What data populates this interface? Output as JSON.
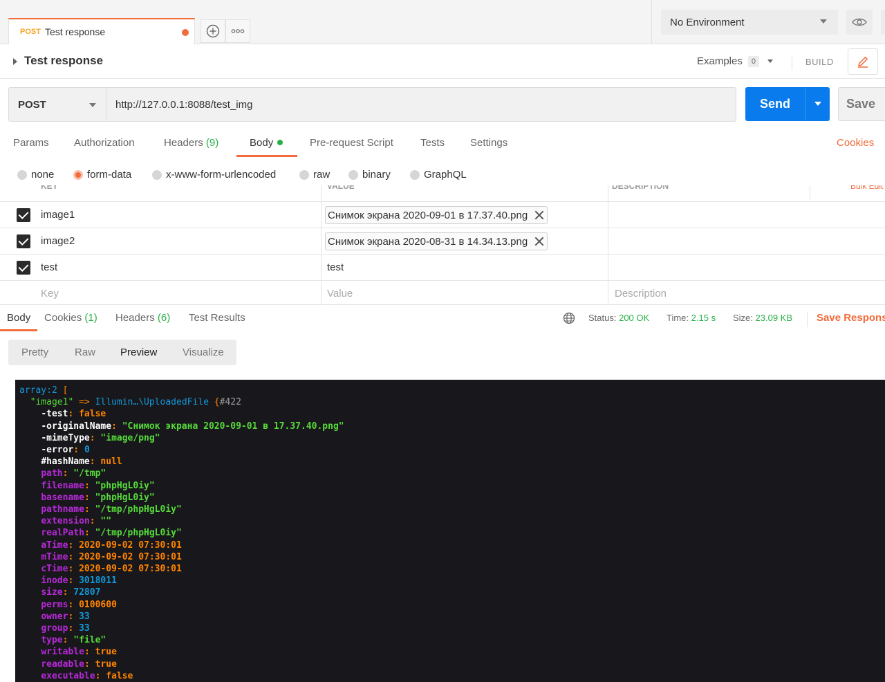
{
  "colors": {
    "accent": "#f26b3a",
    "send_blue": "#097bed",
    "success_green": "#26b047",
    "dump_bg": "#18171b"
  },
  "top_tab": {
    "method": "POST",
    "name": "Test response",
    "new_tab_icon": "plus-circle-icon",
    "more_icon": "ellipsis-icon"
  },
  "environment": {
    "selected": "No Environment",
    "eye_icon": "eye-icon"
  },
  "title_row": {
    "title": "Test response",
    "examples_label": "Examples",
    "examples_count": "0",
    "build_label": "BUILD",
    "edit_icon": "pencil-icon"
  },
  "url_row": {
    "method": "POST",
    "url": "http://127.0.0.1:8088/test_img",
    "send_label": "Send",
    "save_label": "Save"
  },
  "request_tabs": {
    "params": "Params",
    "authorization": "Authorization",
    "headers_label": "Headers",
    "headers_count": "(9)",
    "body": "Body",
    "pre_request": "Pre-request Script",
    "tests": "Tests",
    "settings": "Settings",
    "cookies": "Cookies"
  },
  "body_types": {
    "none": "none",
    "form_data": "form-data",
    "urlencoded": "x-www-form-urlencoded",
    "raw": "raw",
    "binary": "binary",
    "graphql": "GraphQL",
    "selected": "form-data"
  },
  "form_table": {
    "columns": [
      "KEY",
      "VALUE",
      "DESCRIPTION"
    ],
    "bulk_edit": "Bulk Edit",
    "rows": [
      {
        "checked": true,
        "key": "image1",
        "value": "Снимок экрана 2020-09-01 в 17.37.40.png",
        "is_file": true
      },
      {
        "checked": true,
        "key": "image2",
        "value": "Снимок экрана 2020-08-31 в 14.34.13.png",
        "is_file": true
      },
      {
        "checked": true,
        "key": "test",
        "value": "test",
        "is_file": false
      }
    ],
    "key_placeholder": "Key",
    "value_placeholder": "Value",
    "description_placeholder": "Description"
  },
  "response_tabs": {
    "body": "Body",
    "cookies_label": "Cookies",
    "cookies_count": "(1)",
    "headers_label": "Headers",
    "headers_count": "(6)",
    "test_results": "Test Results",
    "globe_icon": "globe-icon"
  },
  "response_status": {
    "status_label": "Status:",
    "status_value": "200 OK",
    "time_label": "Time:",
    "time_value": "2.15 s",
    "size_label": "Size:",
    "size_value": "23.09 KB",
    "save_response": "Save Response"
  },
  "view_modes": {
    "pretty": "Pretty",
    "raw": "Raw",
    "preview": "Preview",
    "visualize": "Visualize",
    "active": "Preview"
  },
  "dump": {
    "header_type": "array:2",
    "header_bracket": "[",
    "entry_key": "\"image1\"",
    "arrow": "=>",
    "class_name": "Illumin…\\UploadedFile",
    "object_open": "{",
    "object_id": "#422",
    "props": [
      {
        "name": "-test",
        "vis": "private",
        "value": "false",
        "type": "const"
      },
      {
        "name": "-originalName",
        "vis": "private",
        "value": "\"Снимок экрана 2020-09-01 в 17.37.40.png\"",
        "type": "str"
      },
      {
        "name": "-mimeType",
        "vis": "private",
        "value": "\"image/png\"",
        "type": "str"
      },
      {
        "name": "-error",
        "vis": "private",
        "value": "0",
        "type": "num"
      },
      {
        "name": "#hashName",
        "vis": "protected",
        "value": "null",
        "type": "const"
      },
      {
        "name": "path",
        "vis": "meta",
        "value": "\"/tmp\"",
        "type": "str"
      },
      {
        "name": "filename",
        "vis": "meta",
        "value": "\"phpHgL0iy\"",
        "type": "str"
      },
      {
        "name": "basename",
        "vis": "meta",
        "value": "\"phpHgL0iy\"",
        "type": "str"
      },
      {
        "name": "pathname",
        "vis": "meta",
        "value": "\"/tmp/phpHgL0iy\"",
        "type": "str"
      },
      {
        "name": "extension",
        "vis": "meta",
        "value": "\"\"",
        "type": "str"
      },
      {
        "name": "realPath",
        "vis": "meta",
        "value": "\"/tmp/phpHgL0iy\"",
        "type": "str"
      },
      {
        "name": "aTime",
        "vis": "meta",
        "value": "2020-09-02 07:30:01",
        "type": "const"
      },
      {
        "name": "mTime",
        "vis": "meta",
        "value": "2020-09-02 07:30:01",
        "type": "const"
      },
      {
        "name": "cTime",
        "vis": "meta",
        "value": "2020-09-02 07:30:01",
        "type": "const"
      },
      {
        "name": "inode",
        "vis": "meta",
        "value": "3018011",
        "type": "num"
      },
      {
        "name": "size",
        "vis": "meta",
        "value": "72807",
        "type": "num"
      },
      {
        "name": "perms",
        "vis": "meta",
        "value": "0100600",
        "type": "const"
      },
      {
        "name": "owner",
        "vis": "meta",
        "value": "33",
        "type": "num"
      },
      {
        "name": "group",
        "vis": "meta",
        "value": "33",
        "type": "num"
      },
      {
        "name": "type",
        "vis": "meta",
        "value": "\"file\"",
        "type": "str"
      },
      {
        "name": "writable",
        "vis": "meta",
        "value": "true",
        "type": "const"
      },
      {
        "name": "readable",
        "vis": "meta",
        "value": "true",
        "type": "const"
      },
      {
        "name": "executable",
        "vis": "meta",
        "value": "false",
        "type": "const"
      }
    ]
  }
}
